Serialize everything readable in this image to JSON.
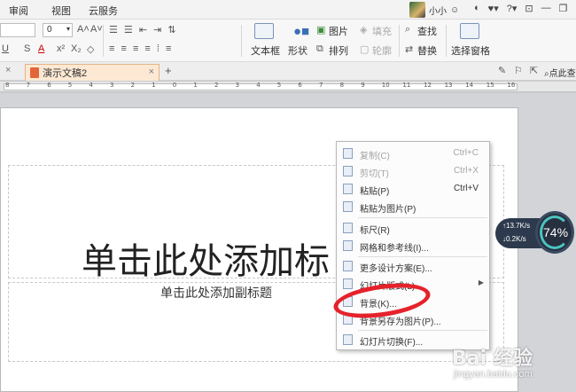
{
  "menubar": {
    "items": [
      "审阅",
      "视图",
      "云服务"
    ],
    "username": "小小",
    "icons": [
      "user-status-icon",
      "theme-icon",
      "skin-icon",
      "help-icon",
      "fullscreen-icon",
      "minimize-icon"
    ]
  },
  "ribbon": {
    "font_size": "0",
    "textbox_label": "文本框",
    "shape_label": "形状",
    "picture_label": "图片",
    "arrange_label": "排列",
    "fill_label": "填充",
    "outline_label": "轮廓",
    "find_label": "查找",
    "replace_label": "替换",
    "selection_pane_label": "选择窗格"
  },
  "tabs": {
    "doc_title": "演示文稿2",
    "close_symbol": "×",
    "add_symbol": "+",
    "search_label": "点此查"
  },
  "ruler": {
    "numbers": [
      "8",
      "7",
      "6",
      "5",
      "4",
      "3",
      "2",
      "1",
      "0",
      "1",
      "2",
      "3",
      "4",
      "5",
      "6",
      "7",
      "8",
      "9",
      "10",
      "11",
      "12",
      "13",
      "14",
      "15",
      "16"
    ]
  },
  "slide": {
    "title_placeholder": "单击此处添加标",
    "subtitle_placeholder": "单击此处添加副标题"
  },
  "context_menu": {
    "items": [
      {
        "label": "复制(C)",
        "shortcut": "Ctrl+C",
        "disabled": true,
        "icon": "copy-icon"
      },
      {
        "label": "剪切(T)",
        "shortcut": "Ctrl+X",
        "disabled": true,
        "icon": "cut-icon"
      },
      {
        "label": "粘贴(P)",
        "shortcut": "Ctrl+V",
        "disabled": false,
        "icon": "paste-icon"
      },
      {
        "label": "粘贴为图片(P)",
        "shortcut": "",
        "disabled": false,
        "icon": "paste-image-icon"
      },
      {
        "label": "标尺(R)",
        "shortcut": "",
        "disabled": false,
        "icon": "ruler-icon"
      },
      {
        "label": "网格和参考线(I)...",
        "shortcut": "",
        "disabled": false,
        "icon": "grid-icon"
      },
      {
        "label": "更多设计方案(E)...",
        "shortcut": "",
        "disabled": false,
        "icon": "design-icon"
      },
      {
        "label": "幻灯片版式(L)",
        "shortcut": "",
        "disabled": false,
        "icon": "layout-icon"
      },
      {
        "label": "背景(K)...",
        "shortcut": "",
        "disabled": false,
        "icon": "background-icon"
      },
      {
        "label": "背景另存为图片(P)...",
        "shortcut": "",
        "disabled": false,
        "icon": "save-background-icon"
      },
      {
        "label": "幻灯片切换(F)...",
        "shortcut": "",
        "disabled": false,
        "icon": "transition-icon"
      }
    ]
  },
  "speed_widget": {
    "upload": "13.7K/s",
    "download": "0.2K/s",
    "percent": "74%"
  },
  "watermark": {
    "logo": "Bai 经验",
    "url": "jingyan.baidu.com"
  }
}
